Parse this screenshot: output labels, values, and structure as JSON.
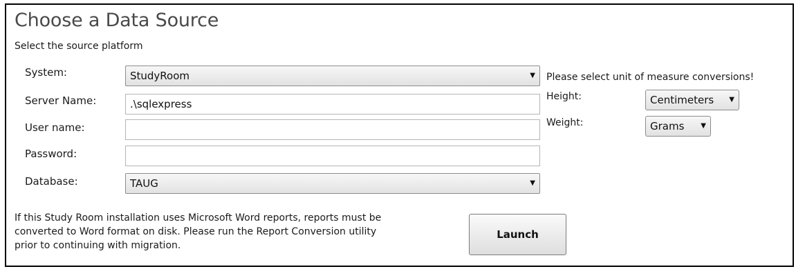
{
  "header": {
    "title": "Choose a Data Source",
    "subtitle": "Select the source platform"
  },
  "form": {
    "system_label": "System:",
    "system_value": "StudyRoom",
    "server_label": "Server Name:",
    "server_value": ".\\sqlexpress",
    "user_label": "User name:",
    "user_value": "",
    "password_label": "Password:",
    "password_value": "",
    "database_label": "Database:",
    "database_value": "TAUG"
  },
  "units": {
    "prompt": "Please select unit of measure conversions!",
    "height_label": "Height:",
    "height_value": "Centimeters",
    "weight_label": "Weight:",
    "weight_value": "Grams"
  },
  "footer": {
    "note_lines": [
      "If this Study Room installation uses Microsoft Word reports, reports must be",
      "converted to Word format on disk.  Please run the Report Conversion utility",
      "prior to continuing with migration."
    ],
    "launch_label": "Launch"
  },
  "icons": {
    "dropdown_arrow": "chevron-down-icon"
  }
}
